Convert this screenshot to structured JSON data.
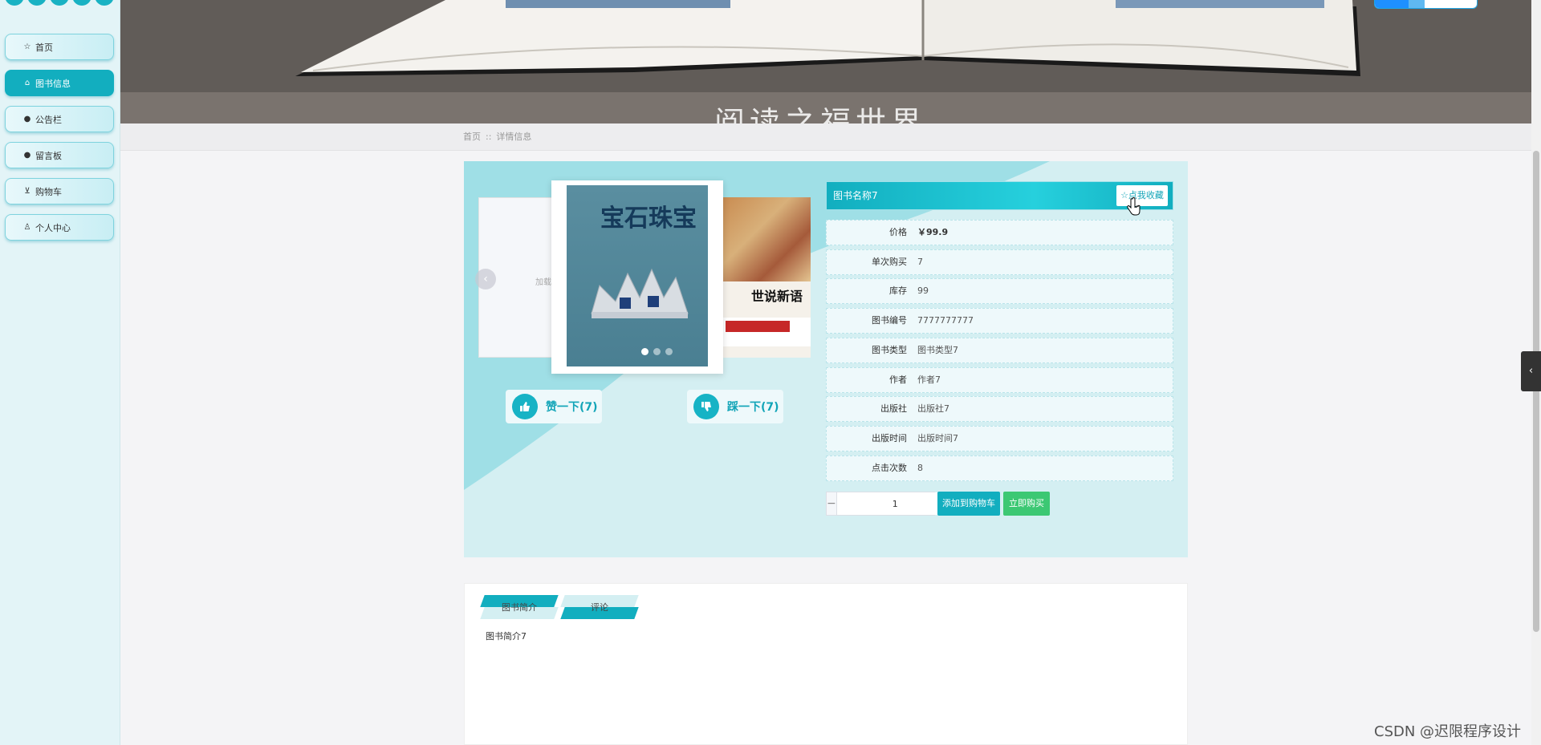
{
  "sidebar": {
    "items": [
      {
        "icon": "star-icon",
        "glyph": "☆",
        "label": "首页",
        "active": false
      },
      {
        "icon": "home-icon",
        "glyph": "⌂",
        "label": "图书信息",
        "active": true
      },
      {
        "icon": "info-icon",
        "glyph": "●",
        "label": "公告栏",
        "active": false
      },
      {
        "icon": "question-icon",
        "glyph": "●",
        "label": "留言板",
        "active": false
      },
      {
        "icon": "cart-icon",
        "glyph": "⊻",
        "label": "购物车",
        "active": false
      },
      {
        "icon": "user-icon",
        "glyph": "♙",
        "label": "个人中心",
        "active": false
      }
    ]
  },
  "hero": {
    "title": "阅读之福世界"
  },
  "breadcrumb": {
    "home": "首页",
    "separator": "::",
    "current": "详情信息"
  },
  "carousel": {
    "loading_text": "加载",
    "right_book_title": "世说新语",
    "main_cover_title": "宝石珠宝"
  },
  "votes": {
    "like": "赞一下(7)",
    "dislike": "踩一下(7)"
  },
  "detail": {
    "book_name": "图书名称7",
    "favorite_label": "☆点我收藏",
    "fields": [
      {
        "label": "价格",
        "value": "￥99.9",
        "price": true
      },
      {
        "label": "单次购买",
        "value": "7"
      },
      {
        "label": "库存",
        "value": "99"
      },
      {
        "label": "图书编号",
        "value": "7777777777"
      },
      {
        "label": "图书类型",
        "value": "图书类型7"
      },
      {
        "label": "作者",
        "value": "作者7"
      },
      {
        "label": "出版社",
        "value": "出版社7"
      },
      {
        "label": "出版时间",
        "value": "出版时间7"
      },
      {
        "label": "点击次数",
        "value": "8"
      }
    ]
  },
  "purchase": {
    "minus": "−",
    "plus": "+",
    "quantity": "1",
    "add_to_cart": "添加到购物车",
    "buy_now": "立即购买"
  },
  "tabs": {
    "items": [
      {
        "label": "图书简介",
        "active": true
      },
      {
        "label": "评论",
        "active": false
      }
    ],
    "content": "图书简介7"
  },
  "watermark": "CSDN @迟限程序设计",
  "colors": {
    "accent": "#12aebf",
    "accent_light": "#d4eff2",
    "buy_green": "#3cc873",
    "sidebar_bg": "#e3f4f7"
  },
  "side_toggle": "‹"
}
